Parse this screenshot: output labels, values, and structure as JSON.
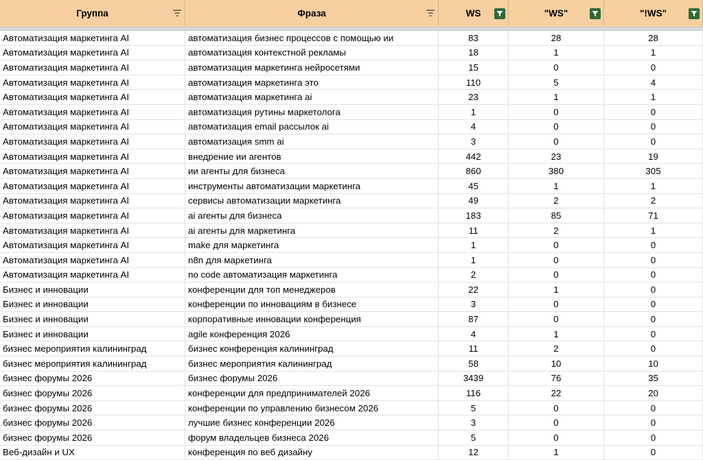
{
  "headers": {
    "group": "Группа",
    "phrase": "Фраза",
    "ws": "WS",
    "ws_quoted": "\"WS\"",
    "ws_exact": "\"!WS\""
  },
  "rows": [
    [
      "Автоматизация маркетинга AI",
      "автоматизация бизнес процессов с помощью ии",
      "83",
      "28",
      "28"
    ],
    [
      "Автоматизация маркетинга AI",
      "автоматизация контекстной рекламы",
      "18",
      "1",
      "1"
    ],
    [
      "Автоматизация маркетинга AI",
      "автоматизация маркетинга нейросетями",
      "15",
      "0",
      "0"
    ],
    [
      "Автоматизация маркетинга AI",
      "автоматизация маркетинга это",
      "110",
      "5",
      "4"
    ],
    [
      "Автоматизация маркетинга AI",
      "автоматизация маркетинга ai",
      "23",
      "1",
      "1"
    ],
    [
      "Автоматизация маркетинга AI",
      "автоматизация рутины маркетолога",
      "1",
      "0",
      "0"
    ],
    [
      "Автоматизация маркетинга AI",
      "автоматизация email рассылок ai",
      "4",
      "0",
      "0"
    ],
    [
      "Автоматизация маркетинга AI",
      "автоматизация smm ai",
      "3",
      "0",
      "0"
    ],
    [
      "Автоматизация маркетинга AI",
      "внедрение ии агентов",
      "442",
      "23",
      "19"
    ],
    [
      "Автоматизация маркетинга AI",
      "ии агенты для бизнеса",
      "860",
      "380",
      "305"
    ],
    [
      "Автоматизация маркетинга AI",
      "инструменты автоматизации маркетинга",
      "45",
      "1",
      "1"
    ],
    [
      "Автоматизация маркетинга AI",
      "сервисы автоматизации маркетинга",
      "49",
      "2",
      "2"
    ],
    [
      "Автоматизация маркетинга AI",
      "ai агенты для бизнеса",
      "183",
      "85",
      "71"
    ],
    [
      "Автоматизация маркетинга AI",
      "ai агенты для маркетинга",
      "11",
      "2",
      "1"
    ],
    [
      "Автоматизация маркетинга AI",
      "make для маркетинга",
      "1",
      "0",
      "0"
    ],
    [
      "Автоматизация маркетинга AI",
      "n8n для маркетинга",
      "1",
      "0",
      "0"
    ],
    [
      "Автоматизация маркетинга AI",
      "no code автоматизация маркетинга",
      "2",
      "0",
      "0"
    ],
    [
      "Бизнес и инновации",
      "конференции для топ менеджеров",
      "22",
      "1",
      "0"
    ],
    [
      "Бизнес и инновации",
      "конференции по инновациям в бизнесе",
      "3",
      "0",
      "0"
    ],
    [
      "Бизнес и инновации",
      "корпоративные инновации конференция",
      "87",
      "0",
      "0"
    ],
    [
      "Бизнес и инновации",
      "agile конференция 2026",
      "4",
      "1",
      "0"
    ],
    [
      "бизнес мероприятия калининград",
      "бизнес конференция калининград",
      "11",
      "2",
      "0"
    ],
    [
      "бизнес мероприятия калининград",
      "бизнес мероприятия калининград",
      "58",
      "10",
      "10"
    ],
    [
      "бизнес форумы 2026",
      "бизнес форумы 2026",
      "3439",
      "76",
      "35"
    ],
    [
      "бизнес форумы 2026",
      "конференции для предпринимателей 2026",
      "116",
      "22",
      "20"
    ],
    [
      "бизнес форумы 2026",
      "конференции по управлению бизнесом 2026",
      "5",
      "0",
      "0"
    ],
    [
      "бизнес форумы 2026",
      "лучшие бизнес конференции 2026",
      "3",
      "0",
      "0"
    ],
    [
      "бизнес форумы 2026",
      "форум владельцев бизнеса 2026",
      "5",
      "0",
      "0"
    ],
    [
      "Веб-дизайн и UX",
      "конференция по веб дизайну",
      "12",
      "1",
      "0"
    ]
  ]
}
